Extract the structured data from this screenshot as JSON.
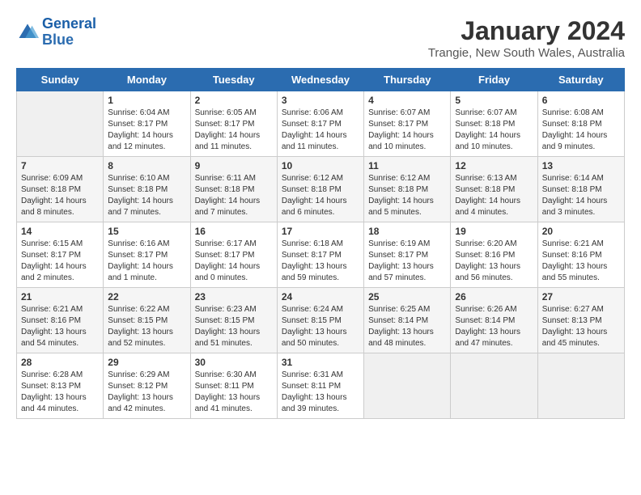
{
  "header": {
    "logo_line1": "General",
    "logo_line2": "Blue",
    "month": "January 2024",
    "location": "Trangie, New South Wales, Australia"
  },
  "weekdays": [
    "Sunday",
    "Monday",
    "Tuesday",
    "Wednesday",
    "Thursday",
    "Friday",
    "Saturday"
  ],
  "weeks": [
    [
      {
        "num": "",
        "info": ""
      },
      {
        "num": "1",
        "info": "Sunrise: 6:04 AM\nSunset: 8:17 PM\nDaylight: 14 hours\nand 12 minutes."
      },
      {
        "num": "2",
        "info": "Sunrise: 6:05 AM\nSunset: 8:17 PM\nDaylight: 14 hours\nand 11 minutes."
      },
      {
        "num": "3",
        "info": "Sunrise: 6:06 AM\nSunset: 8:17 PM\nDaylight: 14 hours\nand 11 minutes."
      },
      {
        "num": "4",
        "info": "Sunrise: 6:07 AM\nSunset: 8:17 PM\nDaylight: 14 hours\nand 10 minutes."
      },
      {
        "num": "5",
        "info": "Sunrise: 6:07 AM\nSunset: 8:18 PM\nDaylight: 14 hours\nand 10 minutes."
      },
      {
        "num": "6",
        "info": "Sunrise: 6:08 AM\nSunset: 8:18 PM\nDaylight: 14 hours\nand 9 minutes."
      }
    ],
    [
      {
        "num": "7",
        "info": "Sunrise: 6:09 AM\nSunset: 8:18 PM\nDaylight: 14 hours\nand 8 minutes."
      },
      {
        "num": "8",
        "info": "Sunrise: 6:10 AM\nSunset: 8:18 PM\nDaylight: 14 hours\nand 7 minutes."
      },
      {
        "num": "9",
        "info": "Sunrise: 6:11 AM\nSunset: 8:18 PM\nDaylight: 14 hours\nand 7 minutes."
      },
      {
        "num": "10",
        "info": "Sunrise: 6:12 AM\nSunset: 8:18 PM\nDaylight: 14 hours\nand 6 minutes."
      },
      {
        "num": "11",
        "info": "Sunrise: 6:12 AM\nSunset: 8:18 PM\nDaylight: 14 hours\nand 5 minutes."
      },
      {
        "num": "12",
        "info": "Sunrise: 6:13 AM\nSunset: 8:18 PM\nDaylight: 14 hours\nand 4 minutes."
      },
      {
        "num": "13",
        "info": "Sunrise: 6:14 AM\nSunset: 8:18 PM\nDaylight: 14 hours\nand 3 minutes."
      }
    ],
    [
      {
        "num": "14",
        "info": "Sunrise: 6:15 AM\nSunset: 8:17 PM\nDaylight: 14 hours\nand 2 minutes."
      },
      {
        "num": "15",
        "info": "Sunrise: 6:16 AM\nSunset: 8:17 PM\nDaylight: 14 hours\nand 1 minute."
      },
      {
        "num": "16",
        "info": "Sunrise: 6:17 AM\nSunset: 8:17 PM\nDaylight: 14 hours\nand 0 minutes."
      },
      {
        "num": "17",
        "info": "Sunrise: 6:18 AM\nSunset: 8:17 PM\nDaylight: 13 hours\nand 59 minutes."
      },
      {
        "num": "18",
        "info": "Sunrise: 6:19 AM\nSunset: 8:17 PM\nDaylight: 13 hours\nand 57 minutes."
      },
      {
        "num": "19",
        "info": "Sunrise: 6:20 AM\nSunset: 8:16 PM\nDaylight: 13 hours\nand 56 minutes."
      },
      {
        "num": "20",
        "info": "Sunrise: 6:21 AM\nSunset: 8:16 PM\nDaylight: 13 hours\nand 55 minutes."
      }
    ],
    [
      {
        "num": "21",
        "info": "Sunrise: 6:21 AM\nSunset: 8:16 PM\nDaylight: 13 hours\nand 54 minutes."
      },
      {
        "num": "22",
        "info": "Sunrise: 6:22 AM\nSunset: 8:15 PM\nDaylight: 13 hours\nand 52 minutes."
      },
      {
        "num": "23",
        "info": "Sunrise: 6:23 AM\nSunset: 8:15 PM\nDaylight: 13 hours\nand 51 minutes."
      },
      {
        "num": "24",
        "info": "Sunrise: 6:24 AM\nSunset: 8:15 PM\nDaylight: 13 hours\nand 50 minutes."
      },
      {
        "num": "25",
        "info": "Sunrise: 6:25 AM\nSunset: 8:14 PM\nDaylight: 13 hours\nand 48 minutes."
      },
      {
        "num": "26",
        "info": "Sunrise: 6:26 AM\nSunset: 8:14 PM\nDaylight: 13 hours\nand 47 minutes."
      },
      {
        "num": "27",
        "info": "Sunrise: 6:27 AM\nSunset: 8:13 PM\nDaylight: 13 hours\nand 45 minutes."
      }
    ],
    [
      {
        "num": "28",
        "info": "Sunrise: 6:28 AM\nSunset: 8:13 PM\nDaylight: 13 hours\nand 44 minutes."
      },
      {
        "num": "29",
        "info": "Sunrise: 6:29 AM\nSunset: 8:12 PM\nDaylight: 13 hours\nand 42 minutes."
      },
      {
        "num": "30",
        "info": "Sunrise: 6:30 AM\nSunset: 8:11 PM\nDaylight: 13 hours\nand 41 minutes."
      },
      {
        "num": "31",
        "info": "Sunrise: 6:31 AM\nSunset: 8:11 PM\nDaylight: 13 hours\nand 39 minutes."
      },
      {
        "num": "",
        "info": ""
      },
      {
        "num": "",
        "info": ""
      },
      {
        "num": "",
        "info": ""
      }
    ]
  ]
}
